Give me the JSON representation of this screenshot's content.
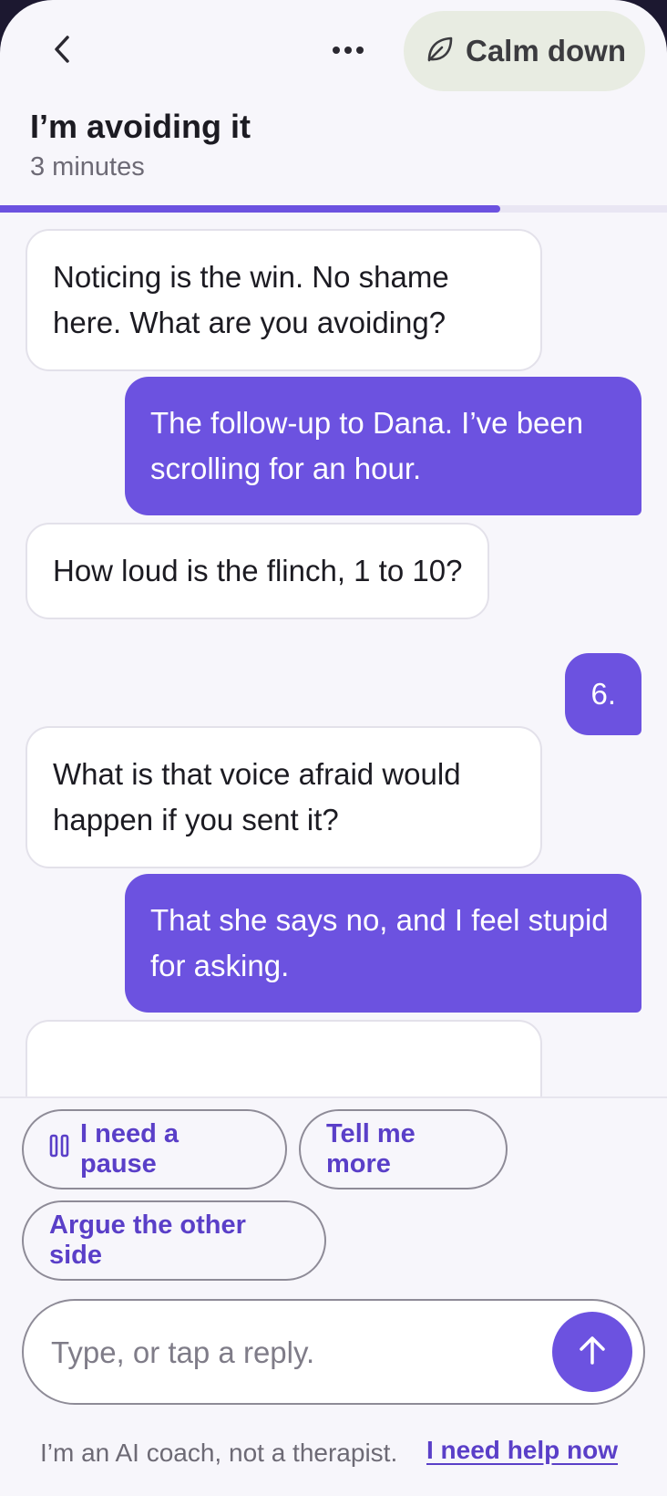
{
  "header": {
    "back_icon": "chevron-left-icon",
    "more_icon": "more-horizontal-icon",
    "calm_button": {
      "icon": "leaf-icon",
      "label": "Calm down"
    }
  },
  "session": {
    "title": "I’m avoiding it",
    "duration": "3 minutes",
    "progress": 0.75
  },
  "messages": [
    {
      "role": "bot",
      "text": "Noticing is the win. No shame here. What are you avoiding?"
    },
    {
      "role": "user",
      "text": "The follow-up to Dana. I’ve been scrolling for an hour."
    },
    {
      "role": "bot",
      "text": "How loud is the flinch, 1 to 10?"
    },
    {
      "role": "user",
      "text": "6."
    },
    {
      "role": "bot",
      "text": "What is that voice afraid would happen if you sent it?"
    },
    {
      "role": "user",
      "text": "That she says no, and I feel stupid for asking."
    }
  ],
  "quick_replies": [
    {
      "label": "I need a pause",
      "icon": "pause-icon"
    },
    {
      "label": "Tell me more"
    },
    {
      "label": "Argue the other side"
    }
  ],
  "composer": {
    "placeholder": "Type, or tap a reply.",
    "send_icon": "arrow-up-icon"
  },
  "footer": {
    "disclaimer": "I’m an AI coach, not a therapist.",
    "help_link": "I need help now"
  },
  "colors": {
    "accent": "#6c52e0",
    "accent_text": "#5a3fc8",
    "background": "#f7f6fb",
    "calm_button_bg": "#e8ece2"
  }
}
